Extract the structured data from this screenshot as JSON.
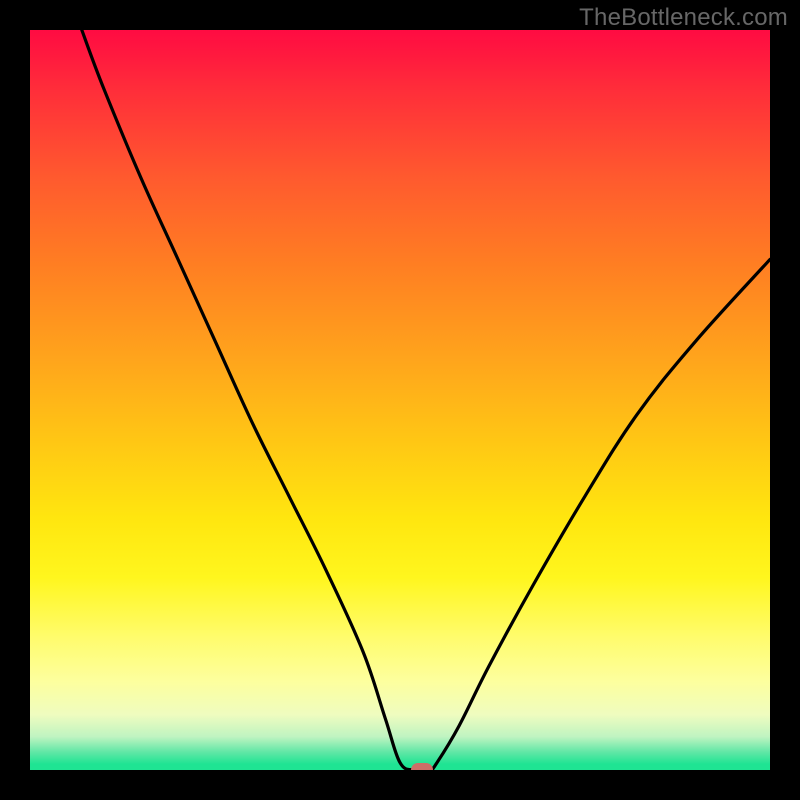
{
  "watermark": "TheBottleneck.com",
  "chart_data": {
    "type": "line",
    "title": "",
    "xlabel": "",
    "ylabel": "",
    "xlim": [
      0,
      100
    ],
    "ylim": [
      0,
      100
    ],
    "grid": false,
    "legend": false,
    "series": [
      {
        "name": "bottleneck-curve",
        "x": [
          7,
          10,
          15,
          20,
          25,
          30,
          35,
          40,
          45,
          48,
          50,
          52,
          54,
          55,
          58,
          62,
          68,
          75,
          82,
          90,
          100
        ],
        "y": [
          100,
          92,
          80,
          69,
          58,
          47,
          37,
          27,
          16,
          7,
          1,
          0,
          0,
          1,
          6,
          14,
          25,
          37,
          48,
          58,
          69
        ]
      }
    ],
    "marker": {
      "x": 53,
      "y": 0,
      "color": "#cc6e67"
    },
    "gradient_stops": [
      {
        "pos": 0,
        "color": "#ff0b42"
      },
      {
        "pos": 0.2,
        "color": "#ff5a2e"
      },
      {
        "pos": 0.44,
        "color": "#ffa31c"
      },
      {
        "pos": 0.66,
        "color": "#ffe60f"
      },
      {
        "pos": 0.88,
        "color": "#fdff9e"
      },
      {
        "pos": 0.97,
        "color": "#64e7a7"
      },
      {
        "pos": 1.0,
        "color": "#1fe493"
      }
    ]
  }
}
